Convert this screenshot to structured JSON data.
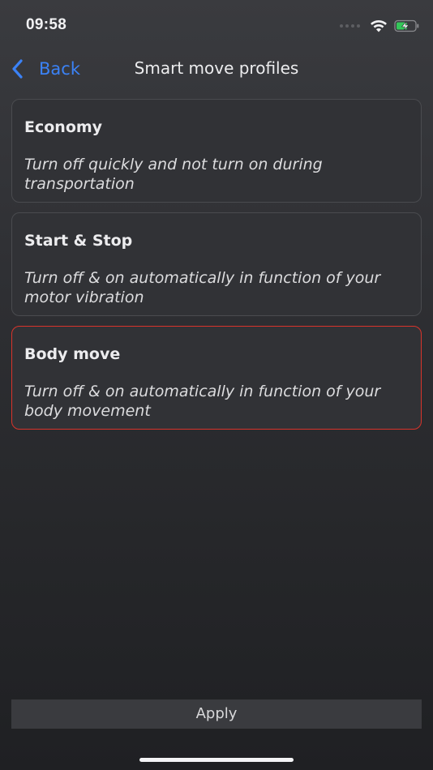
{
  "status_bar": {
    "time": "09:58",
    "icons": [
      "signal-dots-icon",
      "wifi-icon",
      "battery-charging-icon"
    ],
    "battery_color": "#34c759"
  },
  "nav": {
    "back_label": "Back",
    "title": "Smart move profiles",
    "accent_color": "#3b82f6"
  },
  "profiles": [
    {
      "name": "Economy",
      "description": "Turn off quickly and not turn on during transportation",
      "selected": false
    },
    {
      "name": "Start & Stop",
      "description": "Turn off & on automatically in function of your motor vibration",
      "selected": false
    },
    {
      "name": "Body move",
      "description": "Turn off & on automatically in function of your body movement",
      "selected": true
    }
  ],
  "selection_color": "#d9342b",
  "footer": {
    "apply_label": "Apply"
  }
}
